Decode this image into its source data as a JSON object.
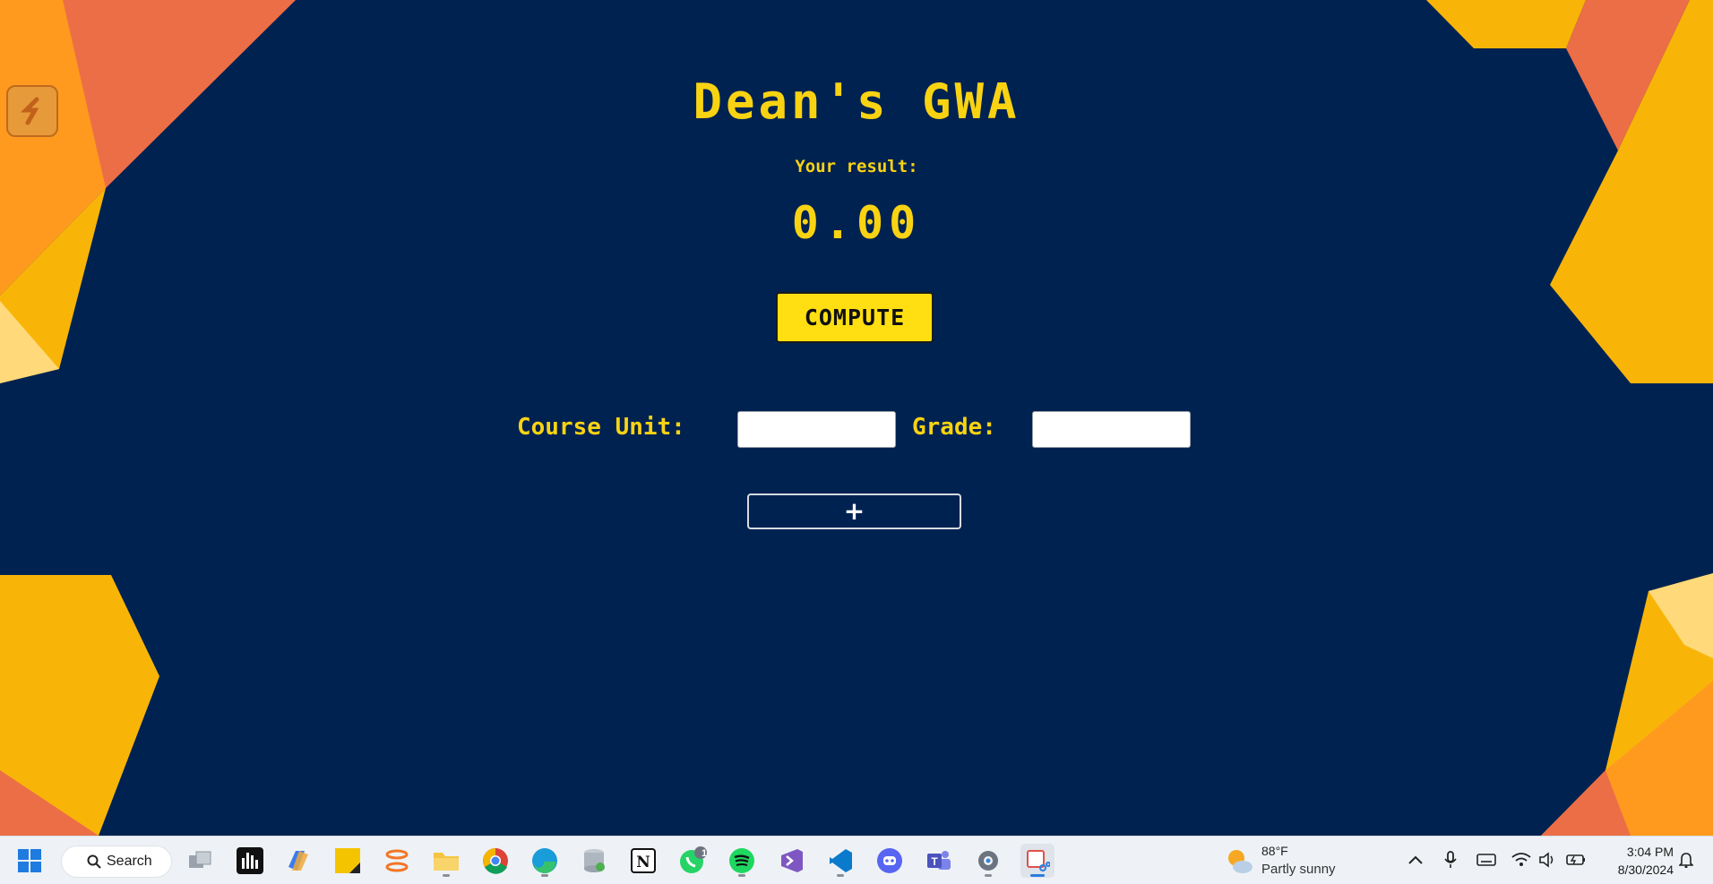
{
  "app": {
    "title": "Dean's GWA",
    "result_label": "Your result:",
    "result_value": "0.00",
    "compute_label": "COMPUTE",
    "course_unit_label": "Course Unit:",
    "grade_label": "Grade:",
    "course_unit_value": "",
    "grade_value": "",
    "add_label": "+"
  },
  "colors": {
    "background": "#002251",
    "accent_yellow": "#f9d312",
    "button_yellow": "#ffdf11",
    "deco_orange": "#ff9a1f",
    "deco_coral": "#ec6e46",
    "deco_gold": "#f8b508",
    "deco_pale": "#ffd97a"
  },
  "taskbar": {
    "search_label": "Search",
    "apps": [
      "windows-start-icon",
      "task-view-icon",
      "audio-app-icon",
      "copilot-icon",
      "sticky-notes-icon",
      "jupyter-icon",
      "file-explorer-icon",
      "chrome-icon",
      "edge-icon",
      "database-app-icon",
      "notion-icon",
      "whatsapp-icon",
      "spotify-icon",
      "visual-studio-icon",
      "vscode-icon",
      "discord-icon",
      "teams-icon",
      "settings-icon",
      "snipping-tool-icon"
    ],
    "whatsapp_badge": "1",
    "weather_temp": "88°F",
    "weather_condition": "Partly sunny",
    "time": "3:04 PM",
    "date": "8/30/2024"
  }
}
